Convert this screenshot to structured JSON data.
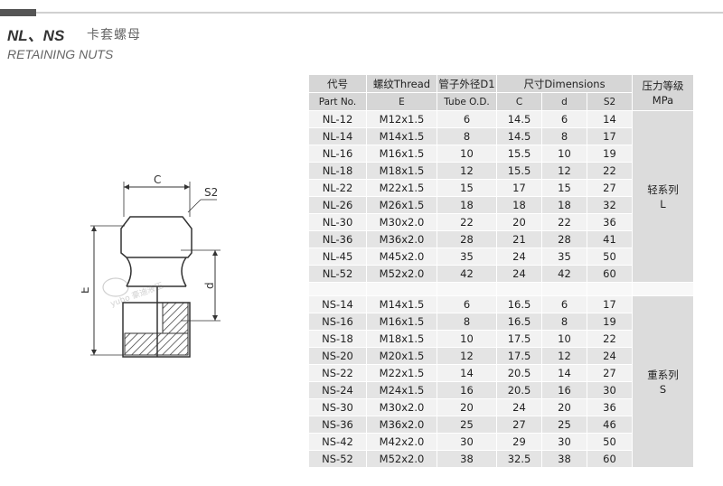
{
  "header": {
    "title": "NL、NS",
    "title_cn": "卡套螺母",
    "subtitle": "RETAINING NUTS"
  },
  "diagram": {
    "labels": {
      "c": "C",
      "s2": "S2",
      "e": "E",
      "d": "d"
    },
    "watermark": "yuho 豪迪液压"
  },
  "table": {
    "headers": {
      "part_cn": "代号",
      "part_en": "Part No.",
      "thread": "螺纹Thread",
      "thread_sub": "E",
      "tube": "管子外径D1",
      "tube_sub": "Tube O.D.",
      "dims": "尺寸Dimensions",
      "dim_c": "C",
      "dim_d": "d",
      "dim_s2": "S2",
      "pressure_cn": "压力等级",
      "pressure_en": "MPa"
    },
    "light_series": {
      "label_cn": "轻系列",
      "label_en": "L",
      "rows": [
        [
          "NL-12",
          "M12x1.5",
          "6",
          "14.5",
          "6",
          "14"
        ],
        [
          "NL-14",
          "M14x1.5",
          "8",
          "14.5",
          "8",
          "17"
        ],
        [
          "NL-16",
          "M16x1.5",
          "10",
          "15.5",
          "10",
          "19"
        ],
        [
          "NL-18",
          "M18x1.5",
          "12",
          "15.5",
          "12",
          "22"
        ],
        [
          "NL-22",
          "M22x1.5",
          "15",
          "17",
          "15",
          "27"
        ],
        [
          "NL-26",
          "M26x1.5",
          "18",
          "18",
          "18",
          "32"
        ],
        [
          "NL-30",
          "M30x2.0",
          "22",
          "20",
          "22",
          "36"
        ],
        [
          "NL-36",
          "M36x2.0",
          "28",
          "21",
          "28",
          "41"
        ],
        [
          "NL-45",
          "M45x2.0",
          "35",
          "24",
          "35",
          "50"
        ],
        [
          "NL-52",
          "M52x2.0",
          "42",
          "24",
          "42",
          "60"
        ]
      ]
    },
    "heavy_series": {
      "label_cn": "重系列",
      "label_en": "S",
      "rows": [
        [
          "NS-14",
          "M14x1.5",
          "6",
          "16.5",
          "6",
          "17"
        ],
        [
          "NS-16",
          "M16x1.5",
          "8",
          "16.5",
          "8",
          "19"
        ],
        [
          "NS-18",
          "M18x1.5",
          "10",
          "17.5",
          "10",
          "22"
        ],
        [
          "NS-20",
          "M20x1.5",
          "12",
          "17.5",
          "12",
          "24"
        ],
        [
          "NS-22",
          "M22x1.5",
          "14",
          "20.5",
          "14",
          "27"
        ],
        [
          "NS-24",
          "M24x1.5",
          "16",
          "20.5",
          "16",
          "30"
        ],
        [
          "NS-30",
          "M30x2.0",
          "20",
          "24",
          "20",
          "36"
        ],
        [
          "NS-36",
          "M36x2.0",
          "25",
          "27",
          "25",
          "46"
        ],
        [
          "NS-42",
          "M42x2.0",
          "30",
          "29",
          "30",
          "50"
        ],
        [
          "NS-52",
          "M52x2.0",
          "38",
          "32.5",
          "38",
          "60"
        ]
      ]
    }
  }
}
